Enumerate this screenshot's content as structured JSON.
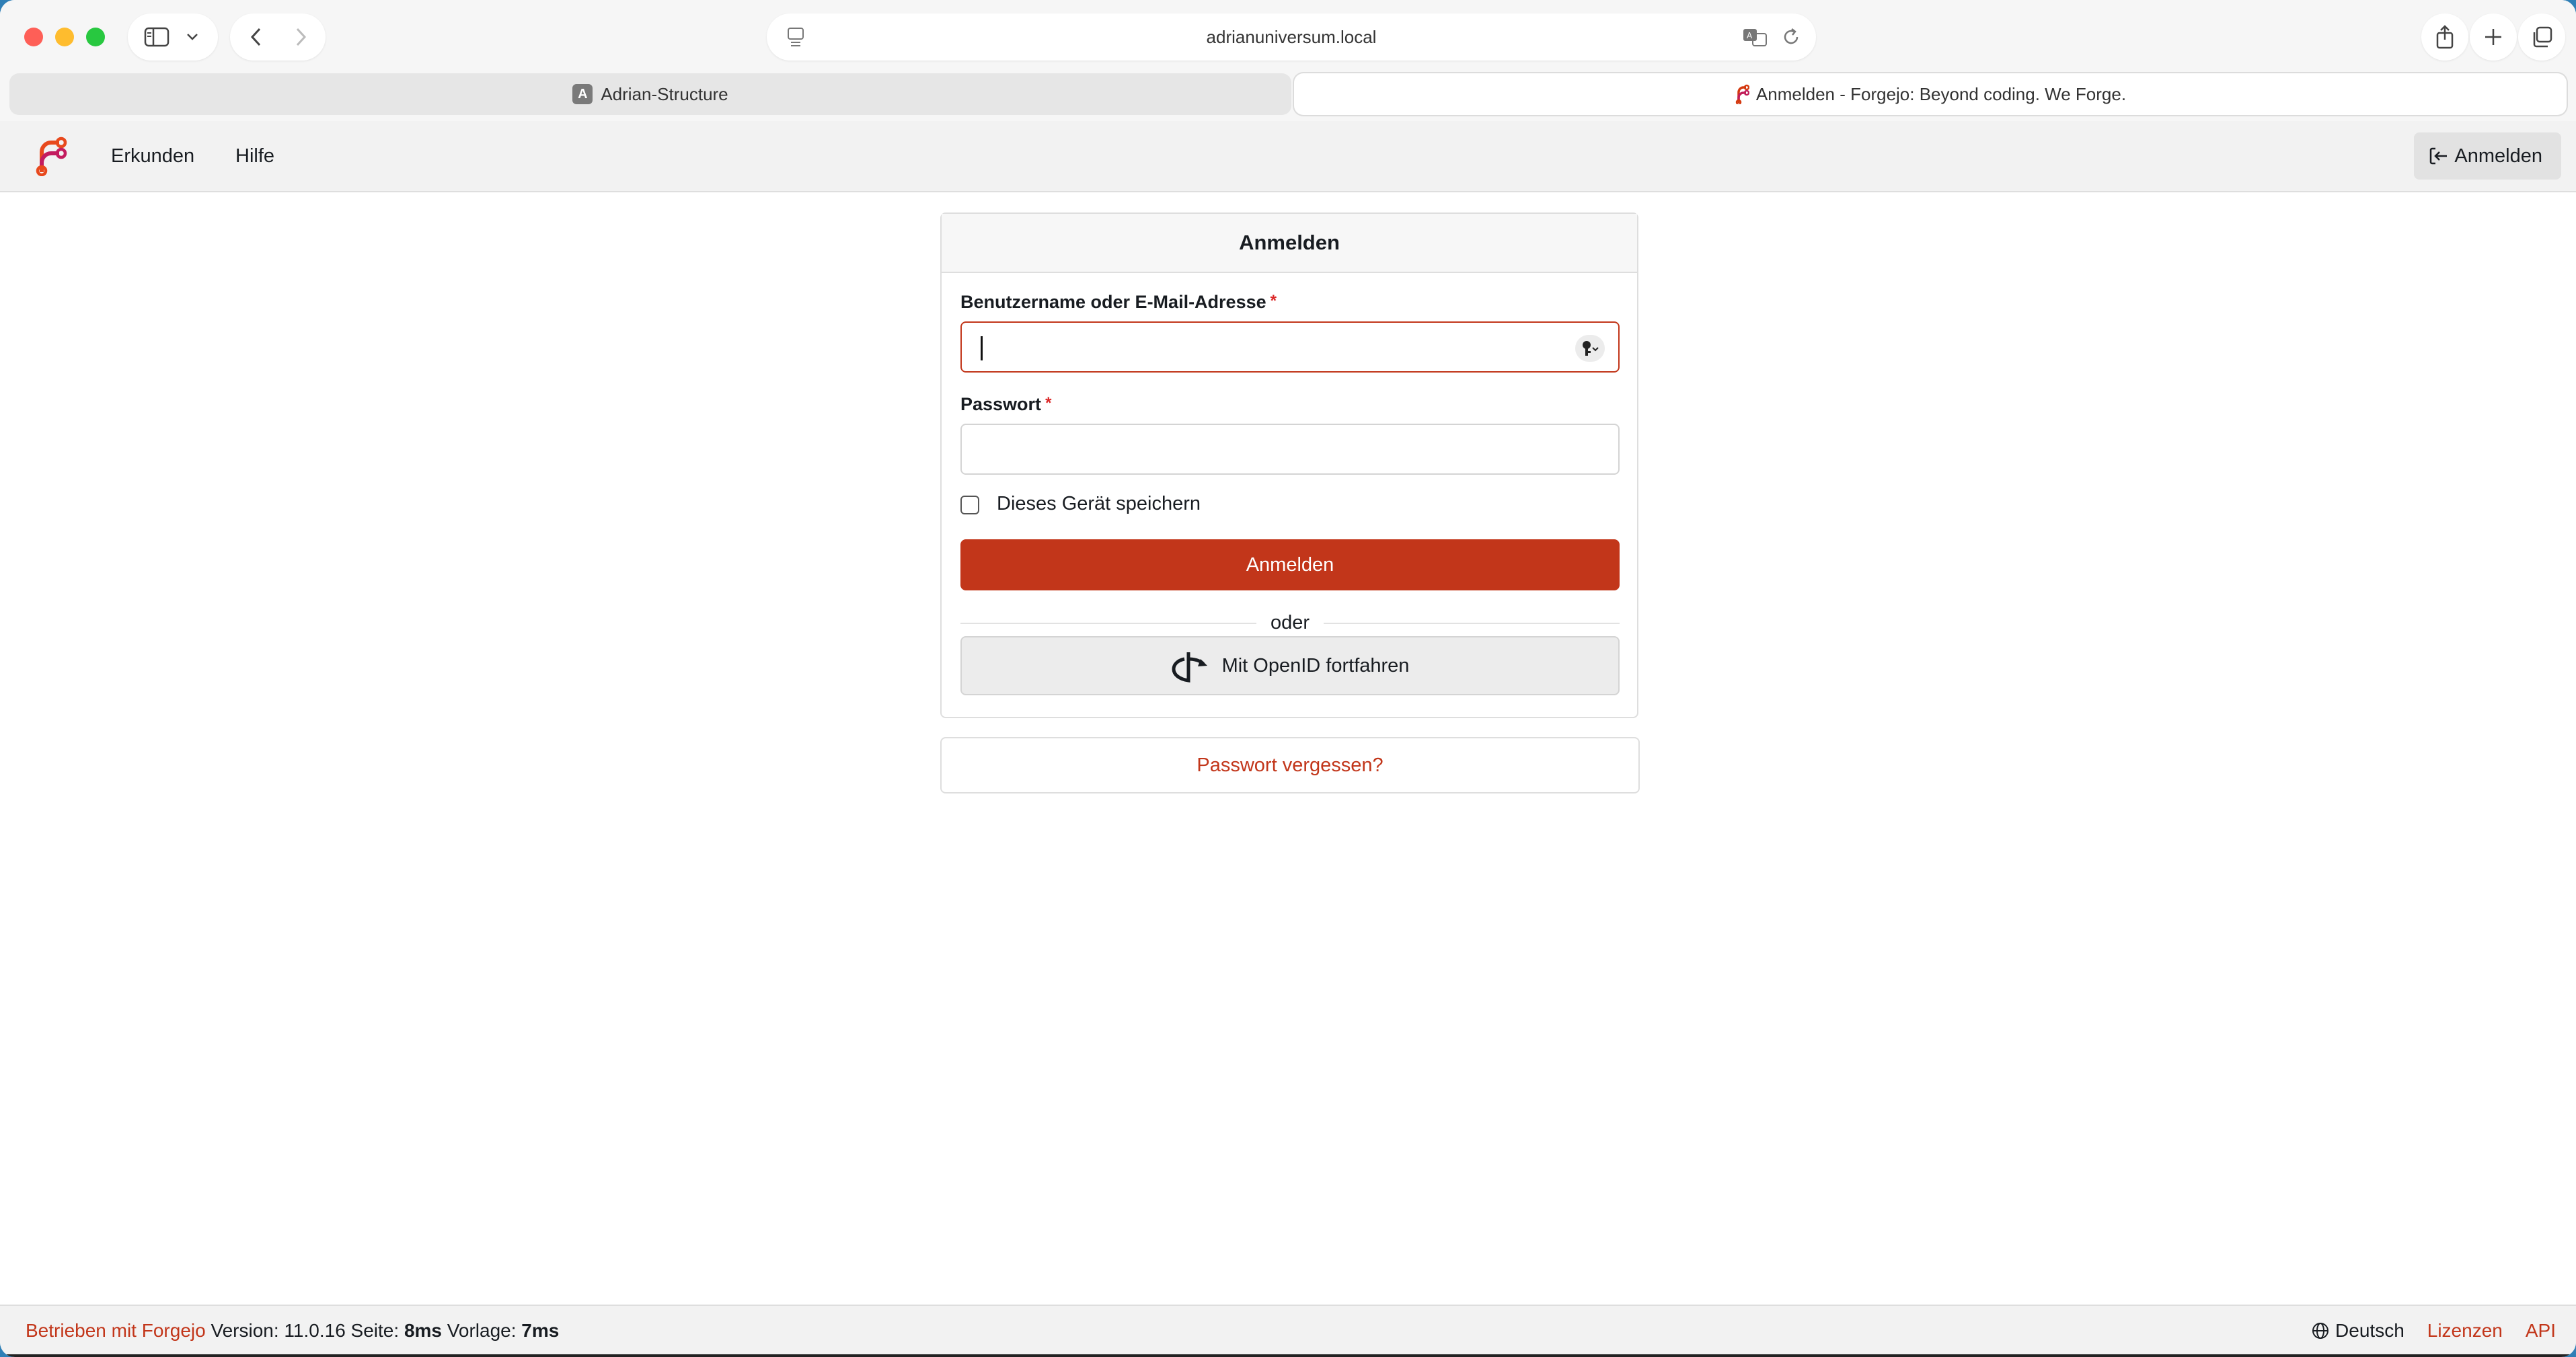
{
  "browser": {
    "address": "adrianuniversum.local",
    "tabs": [
      {
        "label": "Adrian-Structure",
        "favicon_letter": "A",
        "active": false
      },
      {
        "label": "Anmelden - Forgejo: Beyond coding. We Forge.",
        "active": true
      }
    ]
  },
  "navbar": {
    "links": [
      "Erkunden",
      "Hilfe"
    ],
    "login_label": "Anmelden"
  },
  "login_form": {
    "title": "Anmelden",
    "username_label": "Benutzername oder E-Mail-Adresse",
    "username_value": "",
    "password_label": "Passwort",
    "password_value": "",
    "required_marker": "*",
    "remember_label": "Dieses Gerät speichern",
    "remember_checked": false,
    "submit_label": "Anmelden",
    "divider_label": "oder",
    "openid_label": "Mit OpenID fortfahren"
  },
  "forgot_password_label": "Passwort vergessen?",
  "footer": {
    "powered_by": "Betrieben mit Forgejo",
    "version_label": "Version:",
    "version": "11.0.16",
    "page_label": "Seite:",
    "page_time": "8ms",
    "template_label": "Vorlage:",
    "template_time": "7ms",
    "language": "Deutsch",
    "licenses": "Lizenzen",
    "api": "API"
  },
  "colors": {
    "accent": "#c2361a",
    "navbar_bg": "#f2f2f2",
    "required": "#db2828"
  }
}
